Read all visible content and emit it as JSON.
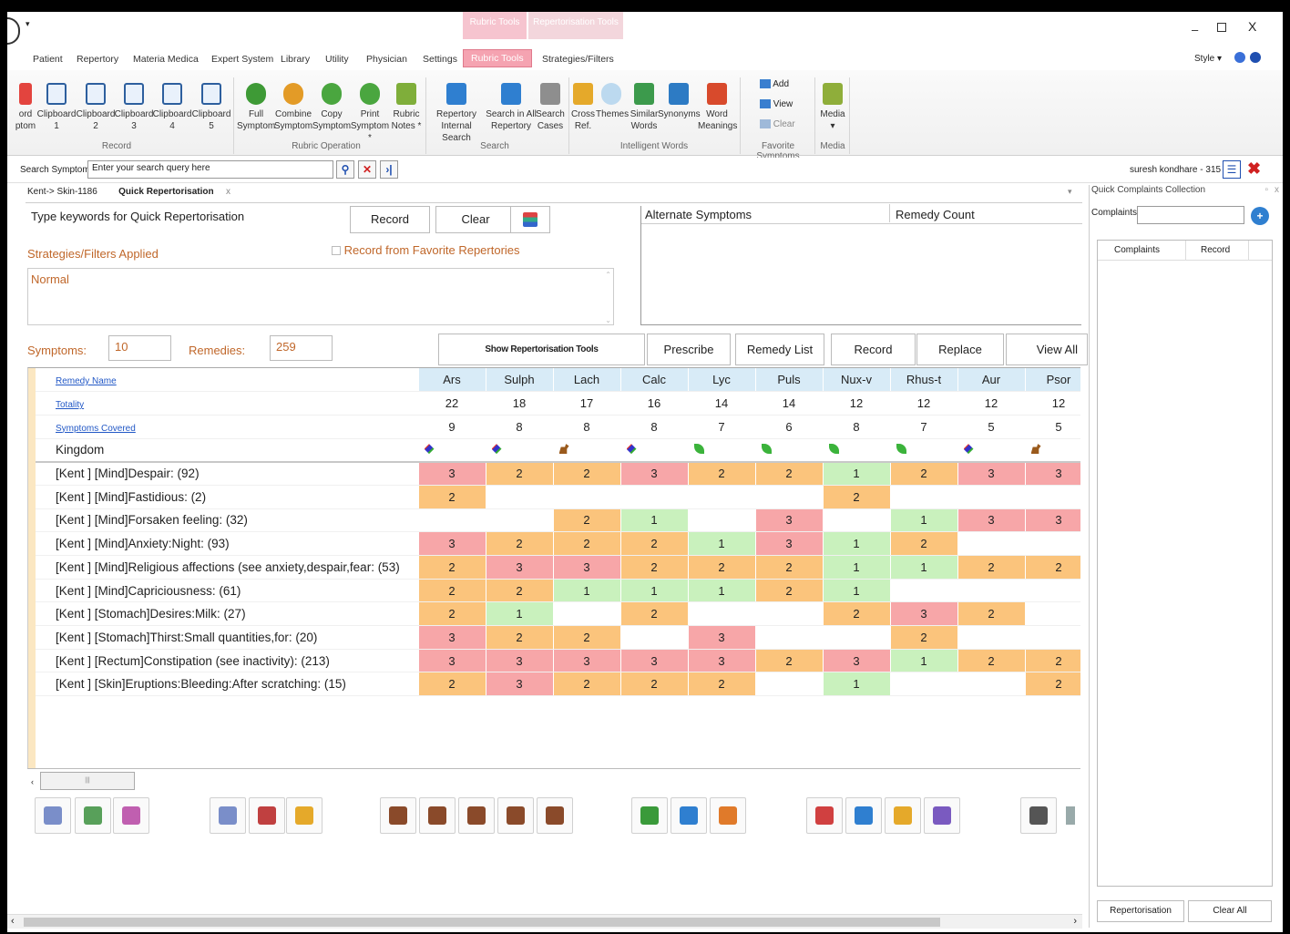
{
  "title_bar": {
    "contextual_tabs": [
      "Rubric Tools",
      "Repertorisation Tools"
    ],
    "window_controls": [
      "minimize-icon",
      "restore-icon",
      "close-icon"
    ],
    "style_label": "Style"
  },
  "menu": [
    "Patient",
    "Repertory",
    "Materia Medica",
    "Expert System",
    "Library",
    "Utility",
    "Physician",
    "Settings",
    "Rubric Tools",
    "Strategies/Filters"
  ],
  "ribbon": {
    "record_group": {
      "label": "Record",
      "items": [
        {
          "l1": "ord",
          "l2": "ptom"
        },
        {
          "l1": "Clipboard",
          "l2": "1"
        },
        {
          "l1": "Clipboard",
          "l2": "2"
        },
        {
          "l1": "Clipboard",
          "l2": "3"
        },
        {
          "l1": "Clipboard",
          "l2": "4"
        },
        {
          "l1": "Clipboard",
          "l2": "5"
        }
      ]
    },
    "rubric_op_group": {
      "label": "Rubric Operation",
      "items": [
        {
          "l1": "Full",
          "l2": "Symptom"
        },
        {
          "l1": "Combine",
          "l2": "Symptom"
        },
        {
          "l1": "Copy",
          "l2": "Symptom"
        },
        {
          "l1": "Print",
          "l2": "Symptom *"
        },
        {
          "l1": "Rubric",
          "l2": "Notes *"
        }
      ]
    },
    "search_group": {
      "label": "Search",
      "items": [
        {
          "l1": "Repertory",
          "l2": "Internal Search"
        },
        {
          "l1": "Search in All",
          "l2": "Repertory"
        },
        {
          "l1": "Search",
          "l2": "Cases"
        }
      ]
    },
    "intelligent_group": {
      "label": "Intelligent Words",
      "items": [
        {
          "l1": "Cross",
          "l2": "Ref."
        },
        {
          "l1": "Themes",
          "l2": ""
        },
        {
          "l1": "Similar",
          "l2": "Words"
        },
        {
          "l1": "Synonyms",
          "l2": ""
        },
        {
          "l1": "Word",
          "l2": "Meanings"
        }
      ]
    },
    "favorite_group": {
      "label": "Favorite Symptoms",
      "items": [
        "Add",
        "View",
        "Clear"
      ]
    },
    "media_group": {
      "label": "Media",
      "item": "Media"
    }
  },
  "search": {
    "label": "Search Symptoms",
    "value": "Enter your search query here",
    "user": "suresh kondhare - 315"
  },
  "tabs": [
    "Kent-> Skin-1186",
    "Quick Repertorisation"
  ],
  "quick": {
    "placeholder": "Type keywords for Quick Repertorisation",
    "record_btn": "Record",
    "clear_btn": "Clear",
    "fav_checkbox": "Record from Favorite Repertories",
    "strategies_label": "Strategies/Filters Applied",
    "strategy_value": "Normal",
    "alt_symptoms_col": "Alternate Symptoms",
    "remedy_count_col": "Remedy Count"
  },
  "counts": {
    "symptoms_label": "Symptoms:",
    "symptoms_value": "10",
    "remedies_label": "Remedies:",
    "remedies_value": "259"
  },
  "action_buttons": [
    "Show Repertorisation Tools",
    "Prescribe",
    "Remedy List",
    "Record",
    "Replace",
    "View All"
  ],
  "grid": {
    "row_labels": [
      "Remedy Name",
      "Totality",
      "Symptoms Covered",
      "Kingdom"
    ],
    "remedies": [
      "Ars",
      "Sulph",
      "Lach",
      "Calc",
      "Lyc",
      "Puls",
      "Nux-v",
      "Rhus-t",
      "Aur",
      "Psor"
    ],
    "totality": [
      "22",
      "18",
      "17",
      "16",
      "14",
      "14",
      "12",
      "12",
      "12",
      "12"
    ],
    "covered": [
      "9",
      "8",
      "8",
      "8",
      "7",
      "6",
      "8",
      "7",
      "5",
      "5"
    ],
    "kingdom": [
      "mineral",
      "mineral",
      "animal",
      "mineral",
      "plant",
      "plant",
      "plant",
      "plant",
      "mineral",
      "animal"
    ],
    "rubrics": [
      {
        "name": "[Kent ] [Mind]Despair: (92)",
        "v": [
          "3",
          "2",
          "2",
          "3",
          "2",
          "2",
          "1",
          "2",
          "3",
          "3"
        ]
      },
      {
        "name": "[Kent ] [Mind]Fastidious: (2)",
        "v": [
          "2",
          "",
          "",
          "",
          "",
          "",
          "2",
          "",
          "",
          ""
        ]
      },
      {
        "name": "[Kent ] [Mind]Forsaken feeling: (32)",
        "v": [
          "",
          "",
          "2",
          "1",
          "",
          "3",
          "",
          "1",
          "3",
          "3"
        ]
      },
      {
        "name": "[Kent ] [Mind]Anxiety:Night: (93)",
        "v": [
          "3",
          "2",
          "2",
          "2",
          "1",
          "3",
          "1",
          "2",
          "",
          ""
        ]
      },
      {
        "name": "[Kent ] [Mind]Religious affections (see anxiety,despair,fear: (53)",
        "v": [
          "2",
          "3",
          "3",
          "2",
          "2",
          "2",
          "1",
          "1",
          "2",
          "2"
        ]
      },
      {
        "name": "[Kent ] [Mind]Capriciousness: (61)",
        "v": [
          "2",
          "2",
          "1",
          "1",
          "1",
          "2",
          "1",
          "",
          "",
          ""
        ]
      },
      {
        "name": "[Kent ] [Stomach]Desires:Milk: (27)",
        "v": [
          "2",
          "1",
          "",
          "2",
          "",
          "",
          "2",
          "3",
          "2",
          ""
        ]
      },
      {
        "name": "[Kent ] [Stomach]Thirst:Small quantities,for: (20)",
        "v": [
          "3",
          "2",
          "2",
          "",
          "3",
          "",
          "",
          "2",
          "",
          ""
        ]
      },
      {
        "name": "[Kent ] [Rectum]Constipation (see inactivity): (213)",
        "v": [
          "3",
          "3",
          "3",
          "3",
          "3",
          "2",
          "3",
          "1",
          "2",
          "2"
        ]
      },
      {
        "name": "[Kent ] [Skin]Eruptions:Bleeding:After scratching: (15)",
        "v": [
          "2",
          "3",
          "2",
          "2",
          "2",
          "",
          "1",
          "",
          "",
          "2"
        ]
      }
    ]
  },
  "right_panel": {
    "title": "Quick Complaints Collection",
    "complaints_label": "Complaints",
    "col_complaints": "Complaints",
    "col_record": "Record",
    "btn_repertorisation": "Repertorisation",
    "btn_clear_all": "Clear All"
  },
  "colors": {
    "grade3": "#f7a6a8",
    "grade2": "#fbc47c",
    "grade1": "#c9f1bd",
    "accent": "#f5a3b1"
  }
}
